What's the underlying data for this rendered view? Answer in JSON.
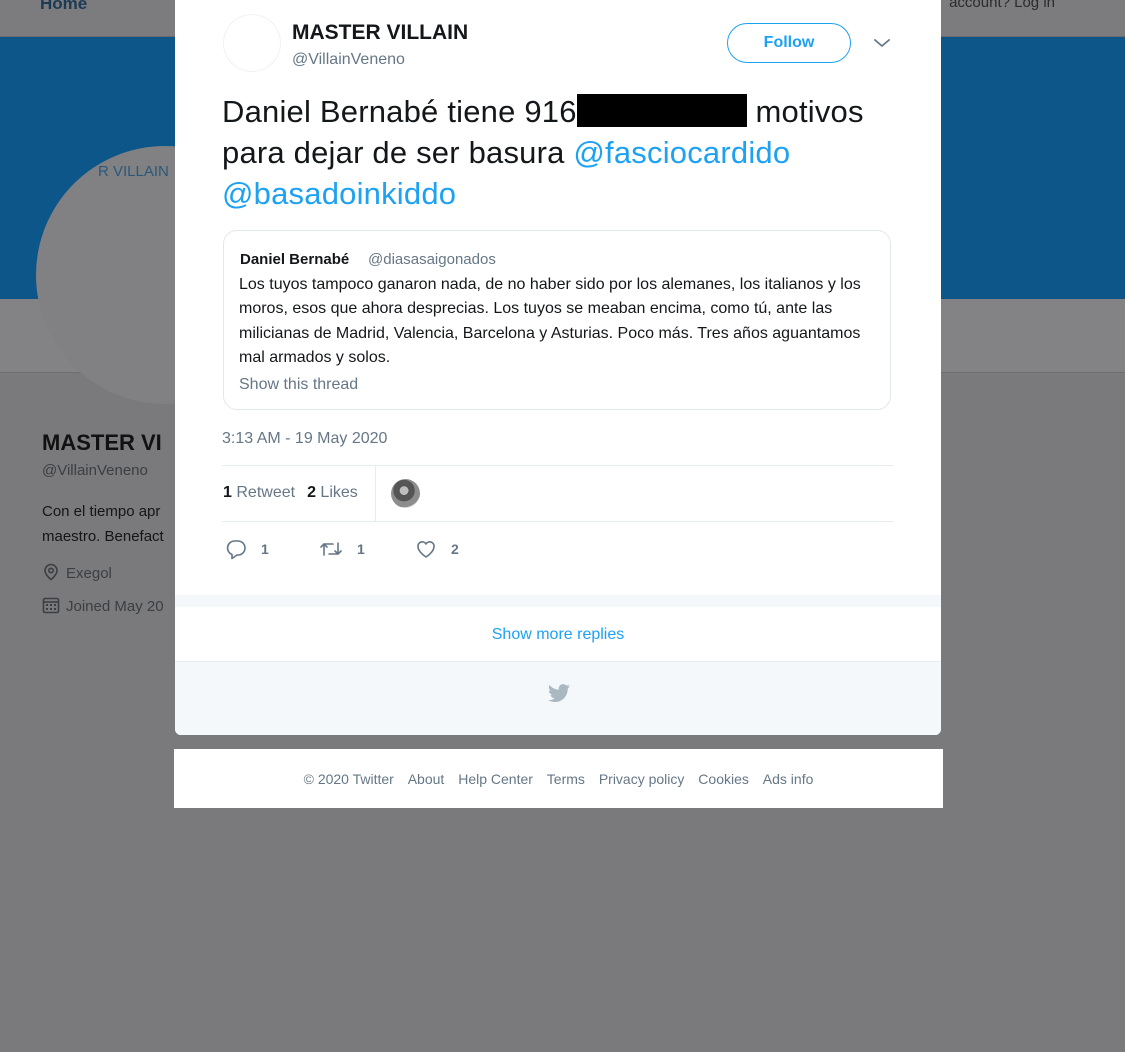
{
  "background": {
    "nav": {
      "home_label": "Home",
      "login_label": "account? Log in"
    },
    "profile": {
      "avatar_text": "R VILLAIN",
      "name": "MASTER VI",
      "handle": "@VillainVeneno",
      "bio_line1": "Con el tiempo apr",
      "bio_line2": "maestro. Benefact",
      "location": "Exegol",
      "joined": "Joined May 20"
    }
  },
  "tweet": {
    "author_name": "MASTER VILLAIN",
    "author_handle": "@VillainVeneno",
    "follow_label": "Follow",
    "text_before": "Daniel Bernabé tiene 916",
    "text_after": " motivos para dejar de ser basura ",
    "mention1": "@fasciocardido",
    "mention2": "@basadoinkiddo",
    "quote": {
      "name": "Daniel Bernabé",
      "handle": "@diasasaigonados",
      "text": "Los tuyos tampoco ganaron nada, de no haber sido por los alemanes, los italianos y los moros, esos que ahora desprecias. Los tuyos se meaban encima, como tú, ante las milicianas de Madrid, Valencia, Barcelona y Asturias. Poco más. Tres años aguantamos mal armados y solos.",
      "show_thread": "Show this thread"
    },
    "timestamp": "3:13 AM - 19 May 2020",
    "retweet_count": "1",
    "retweet_label": "Retweet",
    "like_count": "2",
    "like_label": "Likes",
    "actions": {
      "reply_count": "1",
      "retweet_count": "1",
      "like_count": "2"
    },
    "show_more_replies": "Show more replies"
  },
  "footer": {
    "copyright": "© 2020 Twitter",
    "links": [
      "About",
      "Help Center",
      "Terms",
      "Privacy policy",
      "Cookies",
      "Ads info"
    ]
  },
  "colors": {
    "twitter_blue": "#1da1f2",
    "secondary_text": "#657786",
    "banner": "#0d5689",
    "overlay": "#7a7a7c"
  },
  "icons": [
    "twitter-bird-icon",
    "chevron-down-icon",
    "reply-icon",
    "retweet-icon",
    "heart-icon",
    "location-icon",
    "calendar-icon"
  ]
}
